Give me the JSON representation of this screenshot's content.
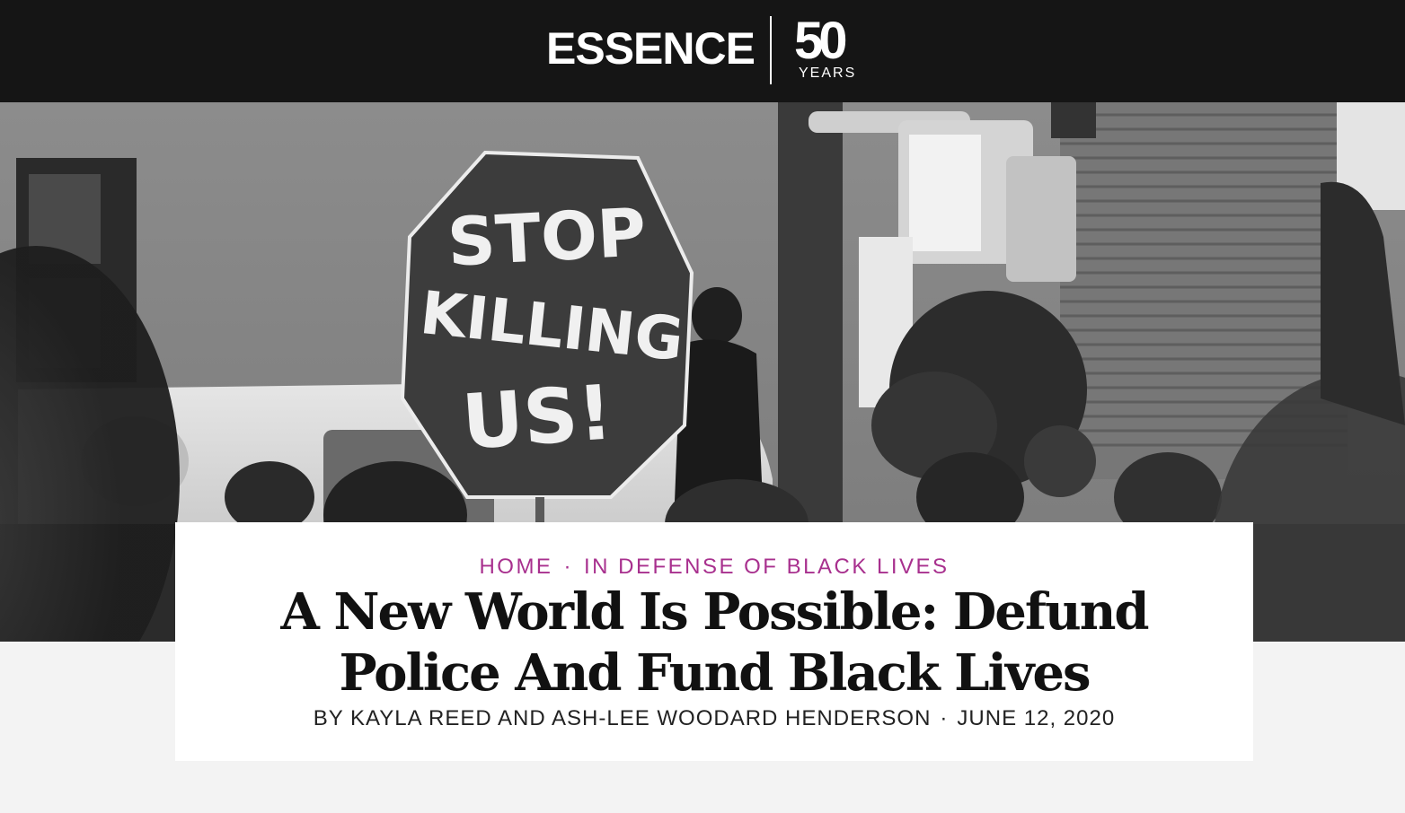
{
  "header": {
    "brand": "ESSENCE",
    "anniversary_number": "50",
    "anniversary_word": "YEARS"
  },
  "hero": {
    "sign_text": [
      "STOP",
      "KILLING",
      "US!"
    ]
  },
  "article": {
    "breadcrumb": [
      {
        "label": "HOME"
      },
      {
        "label": "IN DEFENSE OF BLACK LIVES"
      }
    ],
    "breadcrumb_separator": "·",
    "title": "A New World Is Possible: Defund Police And Fund Black Lives",
    "byline": "BY KAYLA REED AND ASH-LEE WOODARD HENDERSON",
    "byline_separator": "·",
    "date": "JUNE 12, 2020"
  },
  "colors": {
    "header_bg": "#151515",
    "accent": "#a8308e",
    "page_bg": "#f3f3f3",
    "card_bg": "#ffffff"
  }
}
